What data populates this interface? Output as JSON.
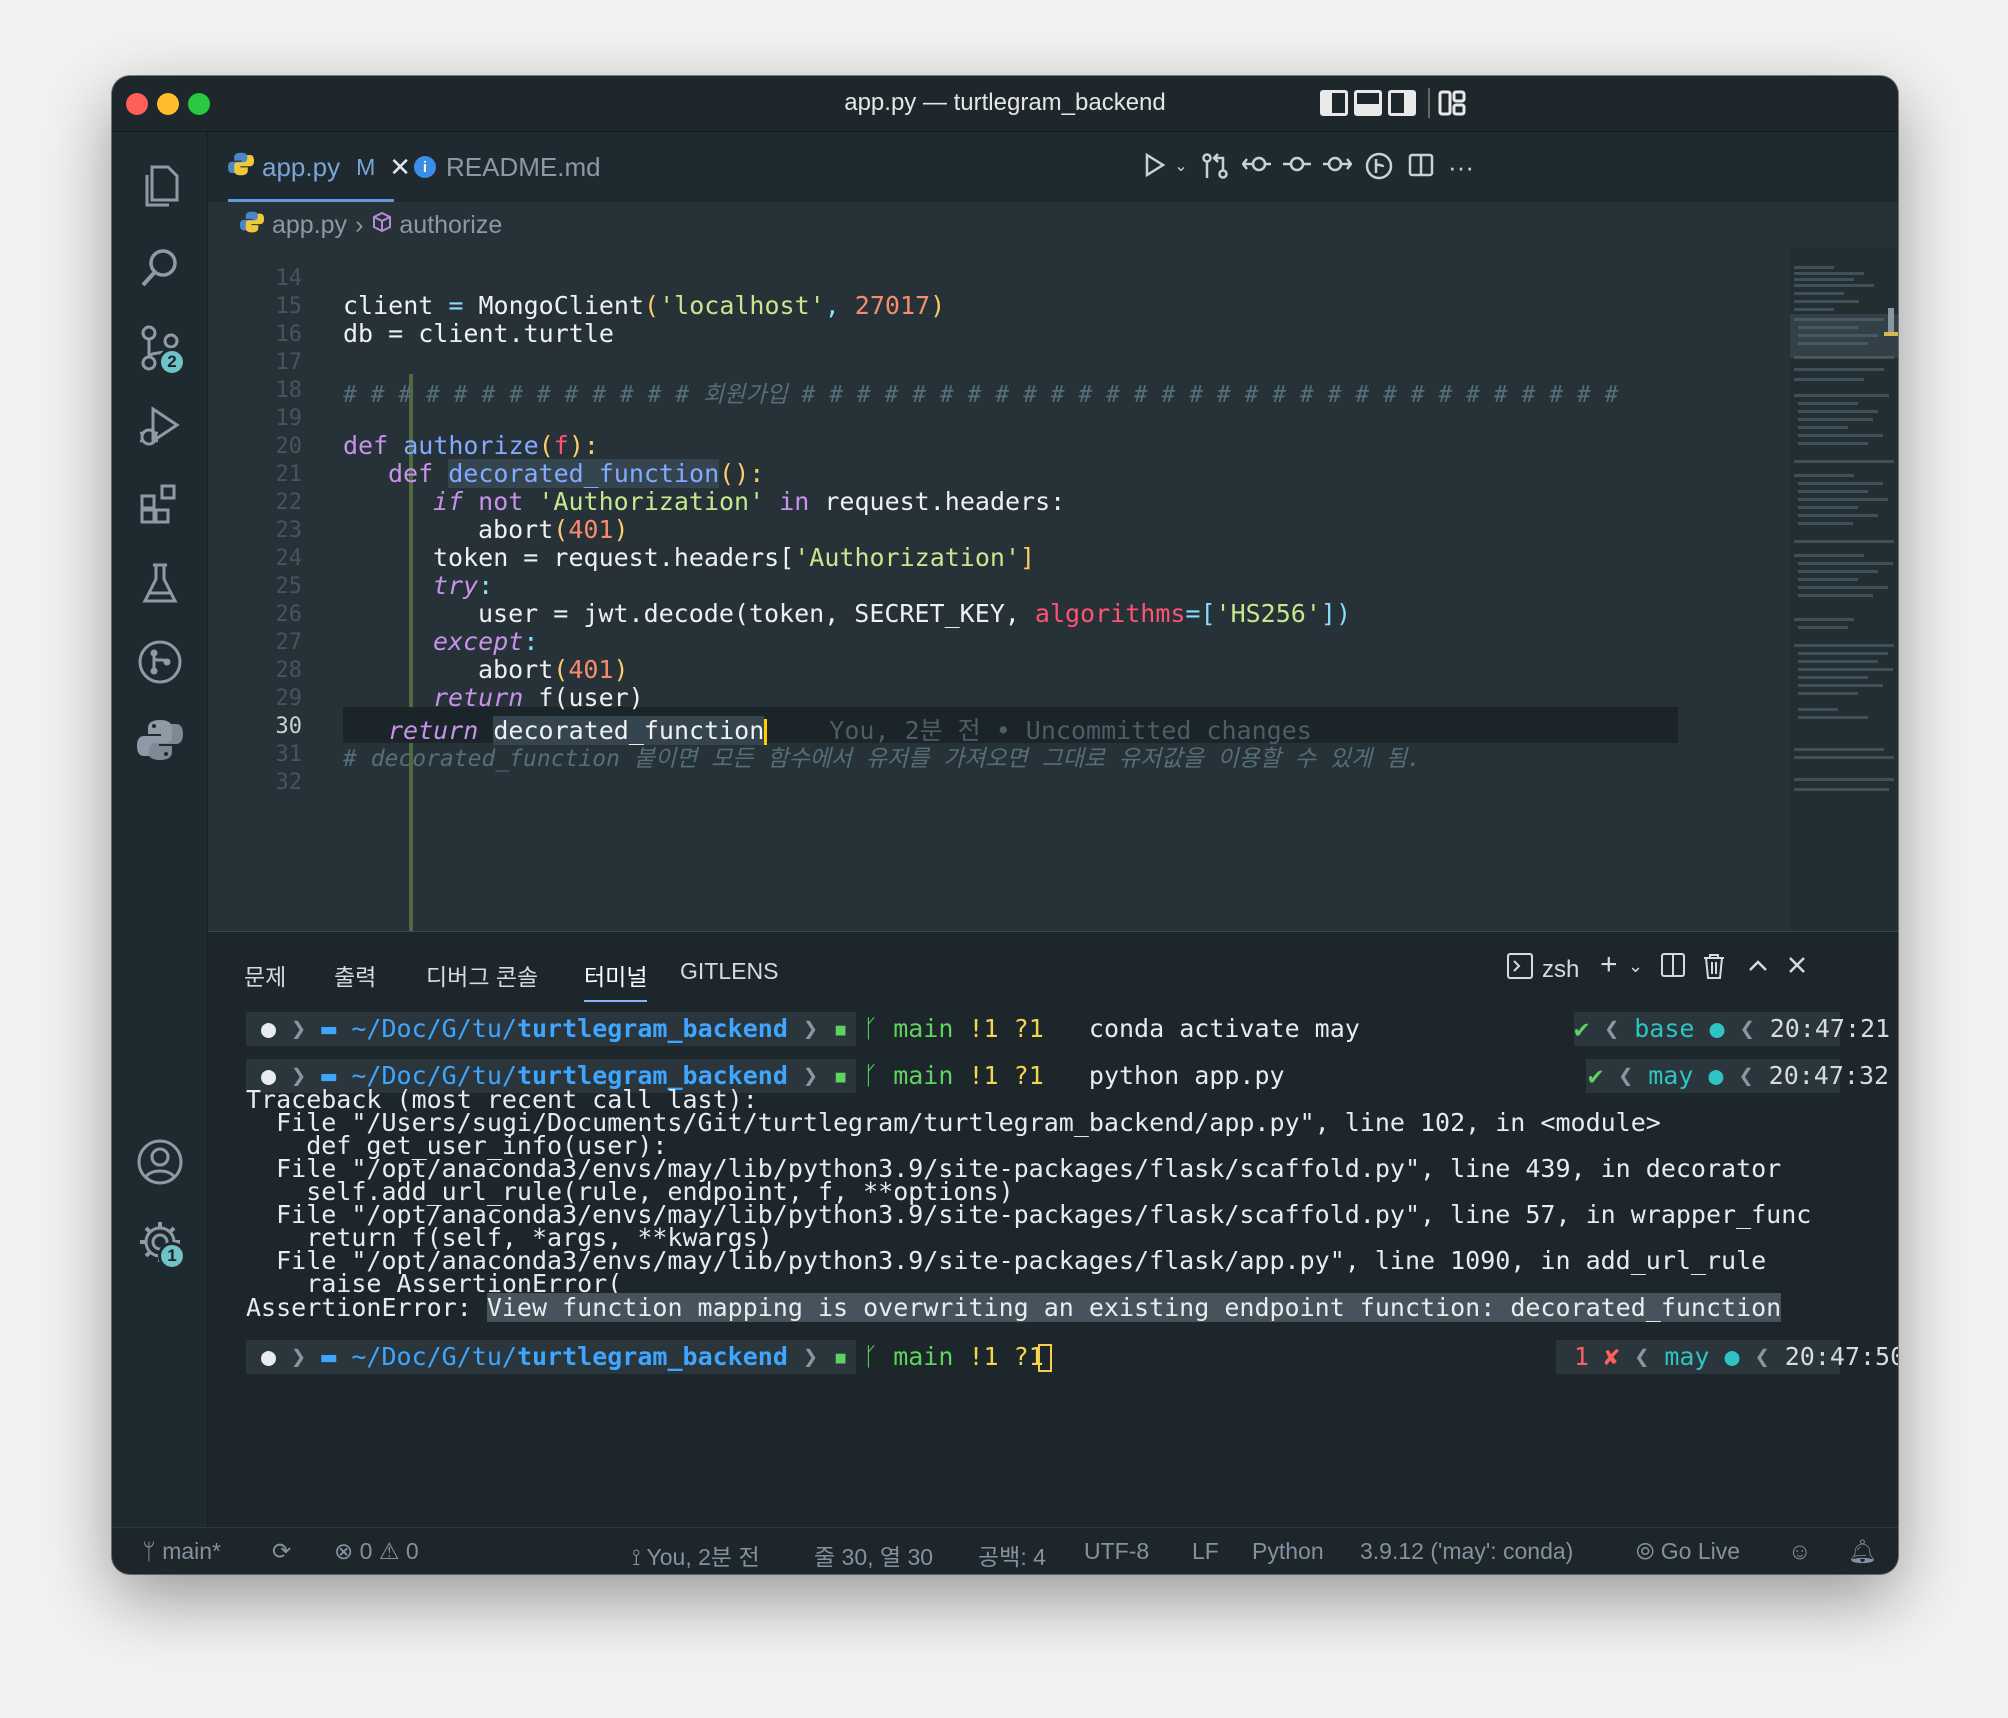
{
  "window": {
    "title": "app.py — turtlegram_backend",
    "traffic_colors": [
      "#fe5f57",
      "#febc2e",
      "#28c840"
    ]
  },
  "activity_bar": {
    "items": [
      {
        "name": "explorer",
        "icon": "files-icon"
      },
      {
        "name": "search",
        "icon": "search-icon"
      },
      {
        "name": "source-control",
        "icon": "source-control-icon",
        "badge": "2"
      },
      {
        "name": "run-debug",
        "icon": "run-debug-icon"
      },
      {
        "name": "extensions",
        "icon": "extensions-icon"
      },
      {
        "name": "testing",
        "icon": "beaker-icon"
      },
      {
        "name": "gitlens",
        "icon": "gitlens-icon"
      },
      {
        "name": "python",
        "icon": "python-icon"
      }
    ],
    "accounts_icon": "account-icon",
    "settings_badge": "1"
  },
  "tabs": [
    {
      "label": "app.py",
      "status": "M",
      "active": true
    },
    {
      "label": "README.md",
      "active": false
    }
  ],
  "breadcrumb": {
    "file": "app.py",
    "symbol": "authorize"
  },
  "editor": {
    "current_line": "30",
    "lines": [
      {
        "n": "14"
      },
      {
        "n": "15"
      },
      {
        "n": "16"
      },
      {
        "n": "17"
      },
      {
        "n": "18"
      },
      {
        "n": "19"
      },
      {
        "n": "20"
      },
      {
        "n": "21"
      },
      {
        "n": "22"
      },
      {
        "n": "23"
      },
      {
        "n": "24"
      },
      {
        "n": "25"
      },
      {
        "n": "26"
      },
      {
        "n": "27"
      },
      {
        "n": "28"
      },
      {
        "n": "29"
      },
      {
        "n": "30"
      },
      {
        "n": "31"
      },
      {
        "n": "32"
      }
    ],
    "code": {
      "l15": [
        "client",
        " = ",
        "MongoClient",
        "(",
        "'localhost'",
        ", ",
        "27017",
        ")"
      ],
      "l16": "db = client.turtle",
      "l18": "# # # # # # # # # # # # # 회원가입 # # # # # # # # # # # # # # # # # # # # # # # # # # # # # #",
      "l20": [
        "def ",
        "authorize",
        "(",
        "f",
        "):"
      ],
      "l21": [
        "def ",
        "decorated_function",
        "():"
      ],
      "l22": [
        "if ",
        "not ",
        "'Authorization'",
        " in ",
        "request.headers:"
      ],
      "l23": [
        "abort",
        "(",
        "401",
        ")"
      ],
      "l24": [
        "token = request.headers[",
        "'Authorization'",
        "]"
      ],
      "l25": [
        "try",
        ":"
      ],
      "l26": [
        "user = jwt.decode(token, SECRET_KEY, ",
        "algorithms",
        "=[",
        "'HS256'",
        "])"
      ],
      "l27": [
        "except",
        ":"
      ],
      "l28": [
        "abort",
        "(",
        "401",
        ")"
      ],
      "l29": [
        "return ",
        "f(user)"
      ],
      "l30": [
        "return ",
        "decorated_function"
      ],
      "l30_blame": "You, 2분 전 • Uncommitted changes",
      "l31": "# decorated_function 붙이면 모든 함수에서 유저를 가져오면 그대로 유저값을 이용할 수 있게 됨."
    }
  },
  "panel": {
    "tabs": [
      "문제",
      "출력",
      "디버그 콘솔",
      "터미널",
      "GITLENS"
    ],
    "active_tab": "터미널",
    "shell": "zsh",
    "prompt": {
      "path_dim": "~/Doc/G/tu/",
      "path_bold": "turtlegram_backend",
      "branch": "main",
      "mods": "!1 ?1"
    },
    "commands": [
      {
        "cmd": "conda activate may",
        "status": "✔",
        "env": "base",
        "time": "20:47:21"
      },
      {
        "cmd": "python app.py",
        "status": "✔",
        "env": "may",
        "time": "20:47:32"
      },
      {
        "cmd": "",
        "status": "1 ✘",
        "env": "may",
        "time": "20:47:50"
      }
    ],
    "traceback": [
      "Traceback (most recent call last):",
      "  File \"/Users/sugi/Documents/Git/turtlegram/turtlegram_backend/app.py\", line 102, in <module>",
      "    def get_user_info(user):",
      "  File \"/opt/anaconda3/envs/may/lib/python3.9/site-packages/flask/scaffold.py\", line 439, in decorator",
      "    self.add_url_rule(rule, endpoint, f, **options)",
      "  File \"/opt/anaconda3/envs/may/lib/python3.9/site-packages/flask/scaffold.py\", line 57, in wrapper_func",
      "    return f(self, *args, **kwargs)",
      "  File \"/opt/anaconda3/envs/may/lib/python3.9/site-packages/flask/app.py\", line 1090, in add_url_rule",
      "    raise AssertionError("
    ],
    "error_prefix": "AssertionError: ",
    "error_message": "View function mapping is overwriting an existing endpoint function: decorated_function"
  },
  "statusbar": {
    "branch": "main*",
    "errors": "0",
    "warnings": "0",
    "blame": "You, 2분 전",
    "position": "줄 30, 열 30",
    "spaces": "공백: 4",
    "encoding": "UTF-8",
    "eol": "LF",
    "language": "Python",
    "interpreter": "3.9.12 ('may': conda)",
    "golive": "Go Live"
  }
}
